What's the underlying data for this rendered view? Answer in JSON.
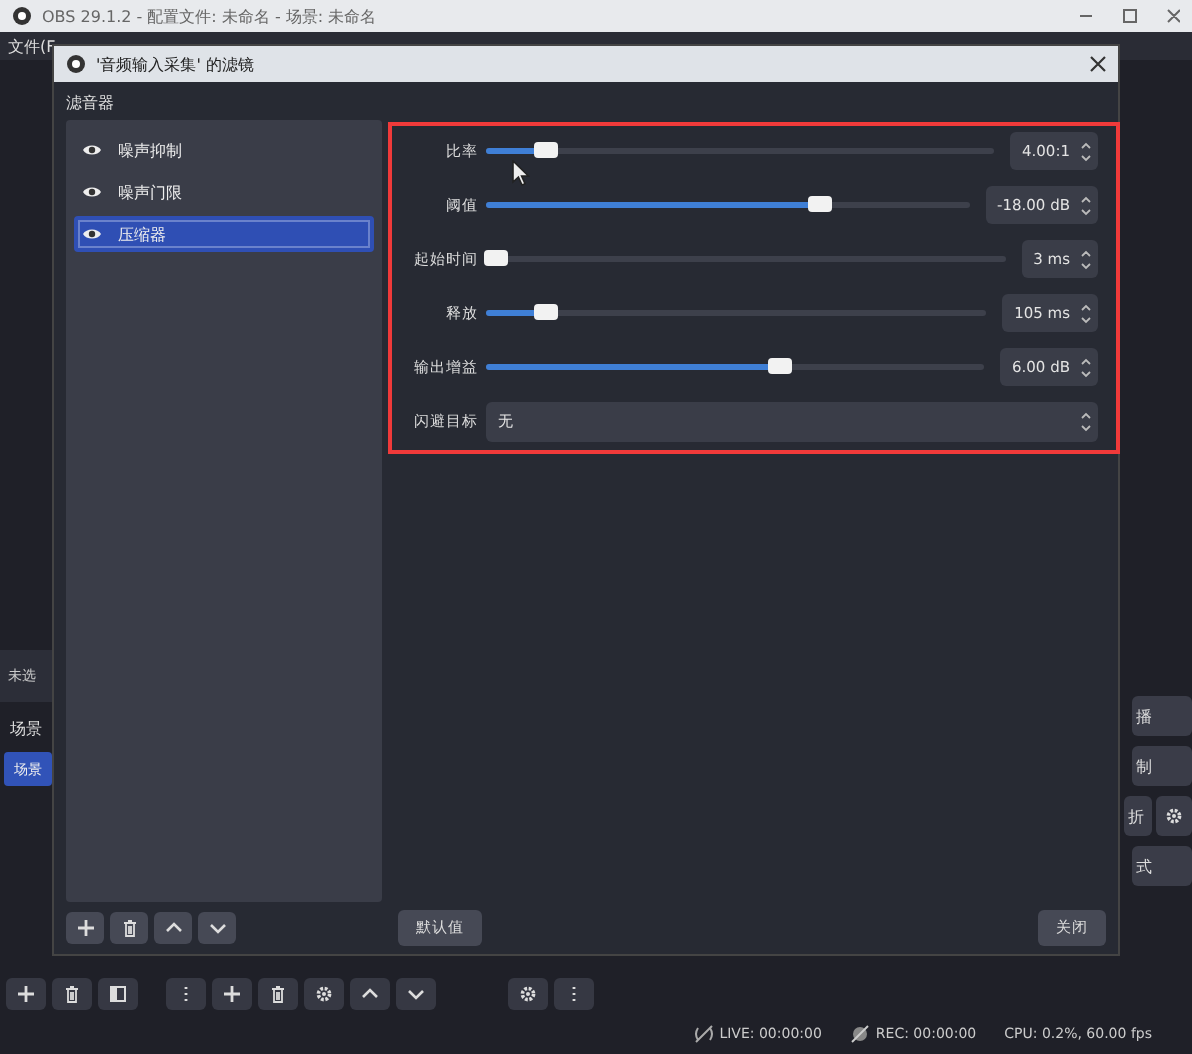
{
  "window": {
    "title": "OBS 29.1.2 - 配置文件: 未命名 - 场景: 未命名",
    "menu": [
      "文件(F"
    ]
  },
  "background": {
    "source_label": "未选",
    "scenes_title": "场景",
    "scenes": [
      {
        "label": "场景",
        "selected": true
      }
    ],
    "right_controls": [
      {
        "label": "播",
        "gear": false
      },
      {
        "label": "制",
        "gear": false
      },
      {
        "label": "折",
        "gear": true
      },
      {
        "label": "式",
        "gear": false
      }
    ]
  },
  "dialog": {
    "title": "'音频输入采集' 的滤镜",
    "section_label": "滤音器",
    "filters": [
      {
        "label": "噪声抑制",
        "visible": true,
        "selected": false
      },
      {
        "label": "噪声门限",
        "visible": true,
        "selected": false
      },
      {
        "label": "压缩器",
        "visible": true,
        "selected": true
      }
    ],
    "controls": [
      {
        "kind": "slider",
        "label": "比率",
        "level": 0.12,
        "value": "4.00:1"
      },
      {
        "kind": "slider",
        "label": "阈值",
        "level": 0.69,
        "value": "-18.00 dB"
      },
      {
        "kind": "slider",
        "label": "起始时间",
        "level": 0.02,
        "value": "3 ms"
      },
      {
        "kind": "slider",
        "label": "释放",
        "level": 0.12,
        "value": "105 ms"
      },
      {
        "kind": "slider",
        "label": "输出增益",
        "level": 0.59,
        "value": "6.00 dB"
      },
      {
        "kind": "select",
        "label": "闪避目标",
        "value": "无"
      }
    ],
    "buttons": {
      "defaults": "默认值",
      "close": "关闭"
    }
  },
  "status_bar": {
    "live": "LIVE: 00:00:00",
    "rec": "REC: 00:00:00",
    "cpu": "CPU: 0.2%, 60.00 fps"
  }
}
